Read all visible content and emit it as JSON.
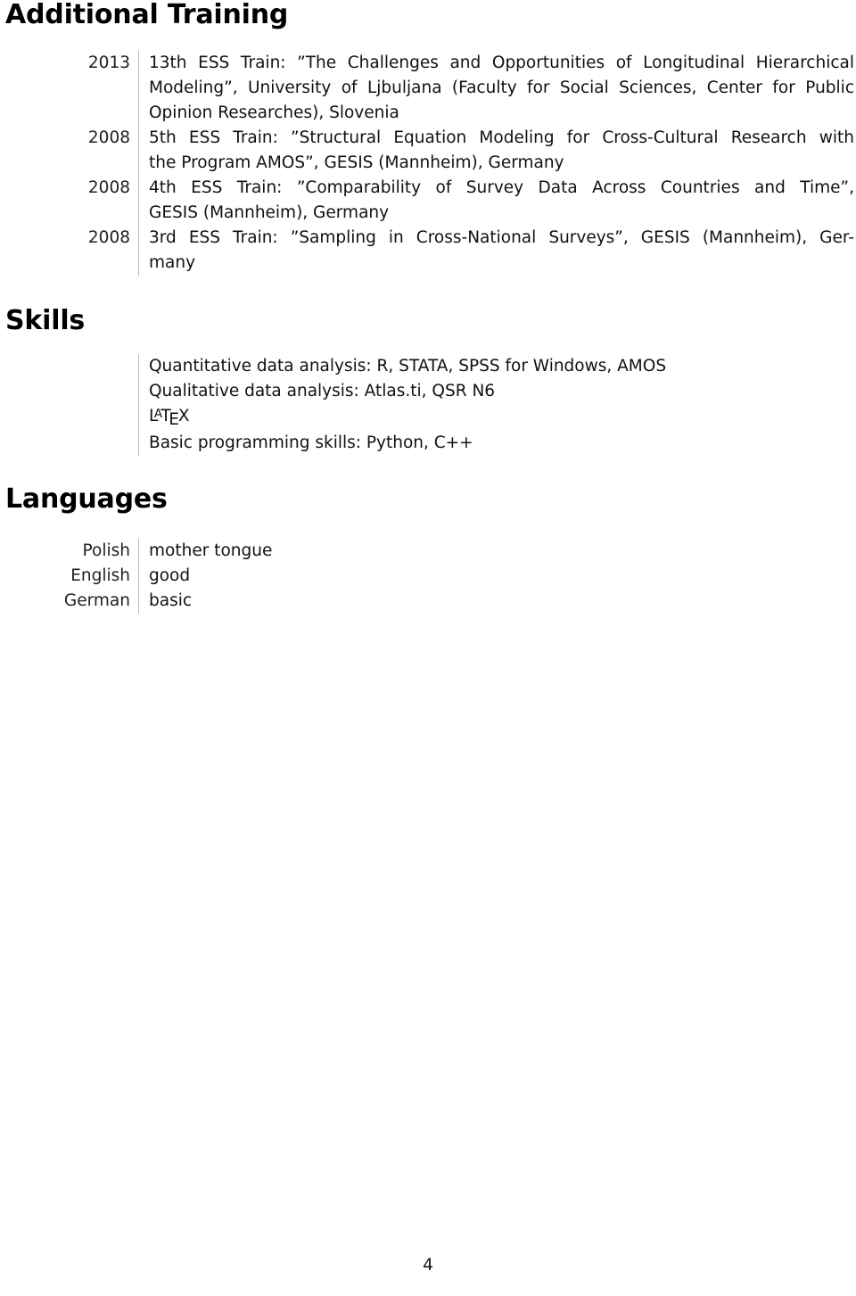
{
  "document": {
    "page_number": "4"
  },
  "sections": {
    "additional_training": {
      "heading": "Additional Training",
      "entries": [
        {
          "year": "2013",
          "lines": [
            {
              "text": "13th ESS Train: ”The Challenges and Opportunities of Longitudinal Hierarchical",
              "justified": true
            },
            {
              "text": "Modeling”, University of Ljbuljana (Faculty for Social Sciences, Center for Public",
              "justified": true
            },
            {
              "text": "Opinion Researches), Slovenia",
              "justified": false
            }
          ]
        },
        {
          "year": "2008",
          "lines": [
            {
              "text": "5th ESS Train: ”Structural Equation Modeling for Cross-Cultural Research with",
              "justified": true
            },
            {
              "text": "the Program AMOS”, GESIS (Mannheim), Germany",
              "justified": false
            }
          ]
        },
        {
          "year": "2008",
          "lines": [
            {
              "text": "4th ESS Train: ”Comparability of Survey Data Across Countries and Time”,",
              "justified": true
            },
            {
              "text": "GESIS (Mannheim), Germany",
              "justified": false
            }
          ]
        },
        {
          "year": "2008",
          "lines": [
            {
              "text": "3rd ESS Train: ”Sampling in Cross-National Surveys”, GESIS (Mannheim), Ger-",
              "justified": true
            },
            {
              "text": "many",
              "justified": false
            }
          ]
        }
      ]
    },
    "skills": {
      "heading": "Skills",
      "items": [
        {
          "type": "text",
          "text": "Quantitative data analysis: R, STATA, SPSS for Windows, AMOS"
        },
        {
          "type": "text",
          "text": "Qualitative data analysis: Atlas.ti, QSR N6"
        },
        {
          "type": "latex",
          "text": "LaTeX",
          "parts": {
            "l": "L",
            "a": "A",
            "t": "T",
            "e": "E",
            "x": "X"
          }
        },
        {
          "type": "text",
          "text": "Basic programming skills: Python, C++"
        }
      ]
    },
    "languages": {
      "heading": "Languages",
      "rows": [
        {
          "language": "Polish",
          "level": "mother tongue"
        },
        {
          "language": "English",
          "level": "good"
        },
        {
          "language": "German",
          "level": "basic"
        }
      ]
    }
  }
}
